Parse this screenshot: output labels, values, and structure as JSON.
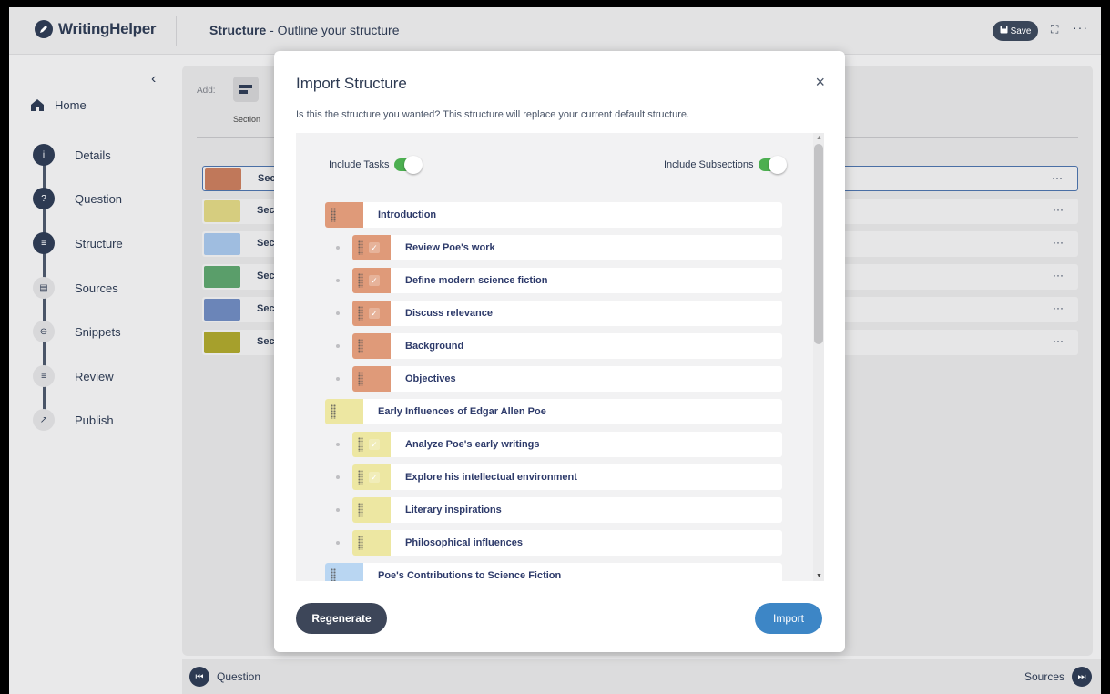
{
  "app": {
    "name": "WritingHelper"
  },
  "header": {
    "title_bold": "Structure",
    "title_rest": " - Outline your structure",
    "save_label": "Save",
    "more": "···",
    "expand": "⛶"
  },
  "sidebar": {
    "home": "Home",
    "steps": [
      {
        "label": "Details",
        "icon": "info-icon"
      },
      {
        "label": "Question",
        "icon": "question-icon"
      },
      {
        "label": "Structure",
        "icon": "structure-icon"
      },
      {
        "label": "Sources",
        "icon": "book-icon"
      },
      {
        "label": "Snippets",
        "icon": "snippet-icon"
      },
      {
        "label": "Review",
        "icon": "review-icon"
      },
      {
        "label": "Publish",
        "icon": "publish-icon"
      }
    ]
  },
  "main": {
    "add_label": "Add:",
    "add_section_label": "Section",
    "rows": [
      {
        "label": "Sec",
        "color": "#c0785a"
      },
      {
        "label": "Sec",
        "color": "#d6cd7f"
      },
      {
        "label": "Sec",
        "color": "#9fbde0"
      },
      {
        "label": "Sec",
        "color": "#5a9e6a"
      },
      {
        "label": "Sec",
        "color": "#6b85b8"
      },
      {
        "label": "Sec",
        "color": "#a6a02c"
      }
    ]
  },
  "footer": {
    "prev": "Question",
    "next": "Sources"
  },
  "modal": {
    "title": "Import Structure",
    "close": "×",
    "description": "Is this the structure you wanted? This structure will replace your current default structure.",
    "include_tasks": "Include Tasks",
    "include_subsections": "Include Subsections",
    "regenerate": "Regenerate",
    "import": "Import",
    "items": [
      {
        "label": "Introduction",
        "level": 0,
        "color": "#df9a79",
        "check": false
      },
      {
        "label": "Review Poe's work",
        "level": 1,
        "color": "#df9a79",
        "check": true
      },
      {
        "label": "Define modern science fiction",
        "level": 1,
        "color": "#df9a79",
        "check": true
      },
      {
        "label": "Discuss relevance",
        "level": 1,
        "color": "#df9a79",
        "check": true
      },
      {
        "label": "Background",
        "level": 1,
        "color": "#df9a79",
        "check": false
      },
      {
        "label": "Objectives",
        "level": 1,
        "color": "#df9a79",
        "check": false
      },
      {
        "label": "Early Influences of Edgar Allen Poe",
        "level": 0,
        "color": "#ede7a2",
        "check": false
      },
      {
        "label": "Analyze Poe's early writings",
        "level": 1,
        "color": "#ede7a2",
        "check": true
      },
      {
        "label": "Explore his intellectual environment",
        "level": 1,
        "color": "#ede7a2",
        "check": true
      },
      {
        "label": "Literary inspirations",
        "level": 1,
        "color": "#ede7a2",
        "check": false
      },
      {
        "label": "Philosophical influences",
        "level": 1,
        "color": "#ede7a2",
        "check": false
      },
      {
        "label": "Poe's Contributions to Science Fiction",
        "level": 0,
        "color": "#b9d6f2",
        "check": false
      }
    ]
  }
}
